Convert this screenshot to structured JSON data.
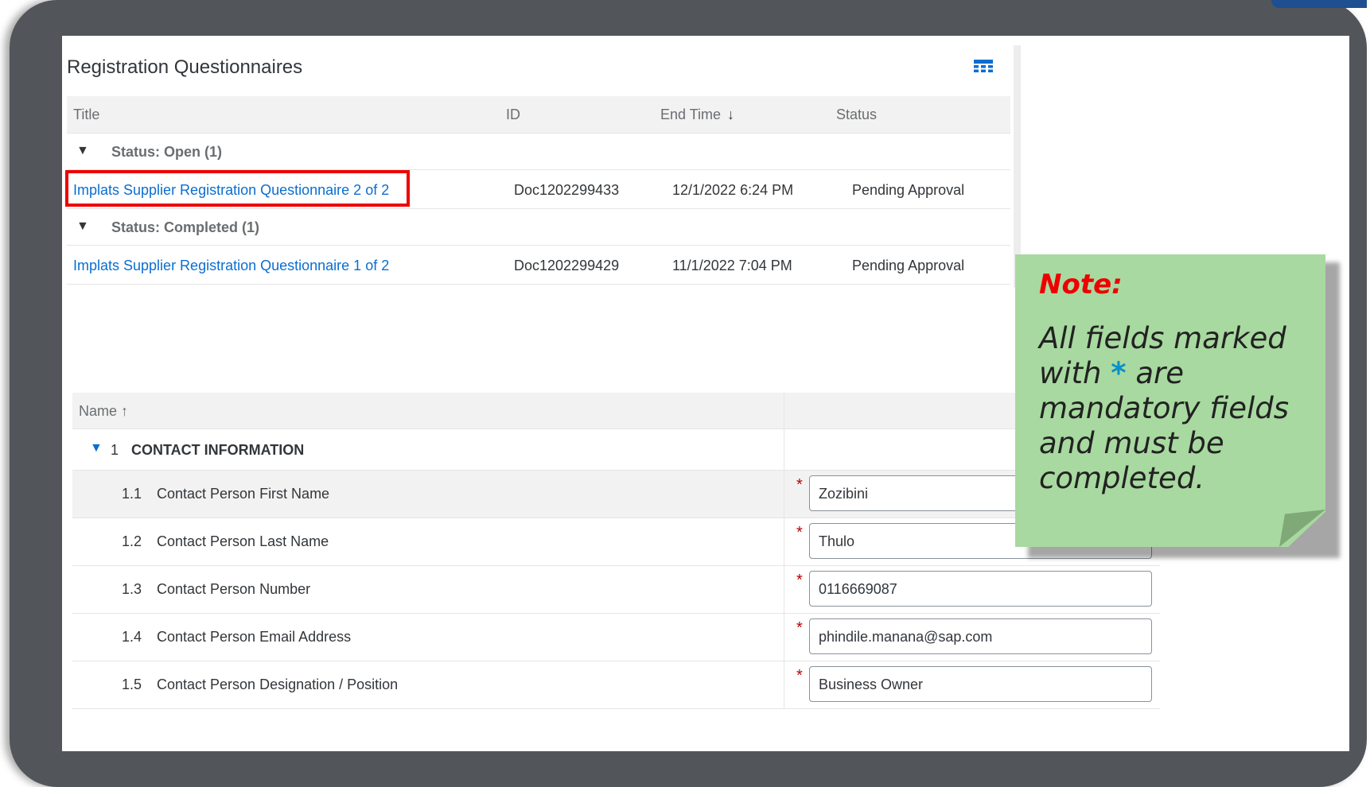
{
  "panel": {
    "title": "Registration Questionnaires"
  },
  "table": {
    "columns": {
      "title": "Title",
      "id": "ID",
      "end_time": "End Time",
      "status": "Status"
    },
    "sort_indicator": "↓",
    "groups": [
      {
        "label": "Status: Open  (1)",
        "rows": [
          {
            "title": "Implats Supplier Registration Questionnaire 2 of 2",
            "id": "Doc1202299433",
            "end_time": "12/1/2022 6:24 PM",
            "status": "Pending Approval"
          }
        ]
      },
      {
        "label": "Status: Completed  (1)",
        "rows": [
          {
            "title": "Implats Supplier Registration Questionnaire 1 of 2",
            "id": "Doc1202299429",
            "end_time": "11/1/2022 7:04 PM",
            "status": "Pending Approval"
          }
        ]
      }
    ]
  },
  "form": {
    "header_name": "Name",
    "header_sort": "↑",
    "section": {
      "number": "1",
      "title": "CONTACT INFORMATION"
    },
    "required_marker": "*",
    "fields": [
      {
        "number": "1.1",
        "label": "Contact Person First Name",
        "value": "Zozibini"
      },
      {
        "number": "1.2",
        "label": "Contact Person Last Name",
        "value": "Thulo"
      },
      {
        "number": "1.3",
        "label": "Contact Person Number",
        "value": "0116669087"
      },
      {
        "number": "1.4",
        "label": "Contact Person Email Address",
        "value": "phindile.manana@sap.com"
      },
      {
        "number": "1.5",
        "label": "Contact Person Designation / Position",
        "value": "Business Owner"
      }
    ]
  },
  "note": {
    "title": "Note:",
    "body_before": "All fields marked with ",
    "asterisk": "*",
    "body_after": " are mandatory fields and must be completed."
  },
  "icons": {
    "table_settings": "table-settings-icon",
    "group_collapse": "triangle-down-icon"
  },
  "colors": {
    "link": "#0a6ed1",
    "highlight": "#ee0000",
    "note_bg": "#a8d9a0",
    "required": "#bb0000"
  }
}
